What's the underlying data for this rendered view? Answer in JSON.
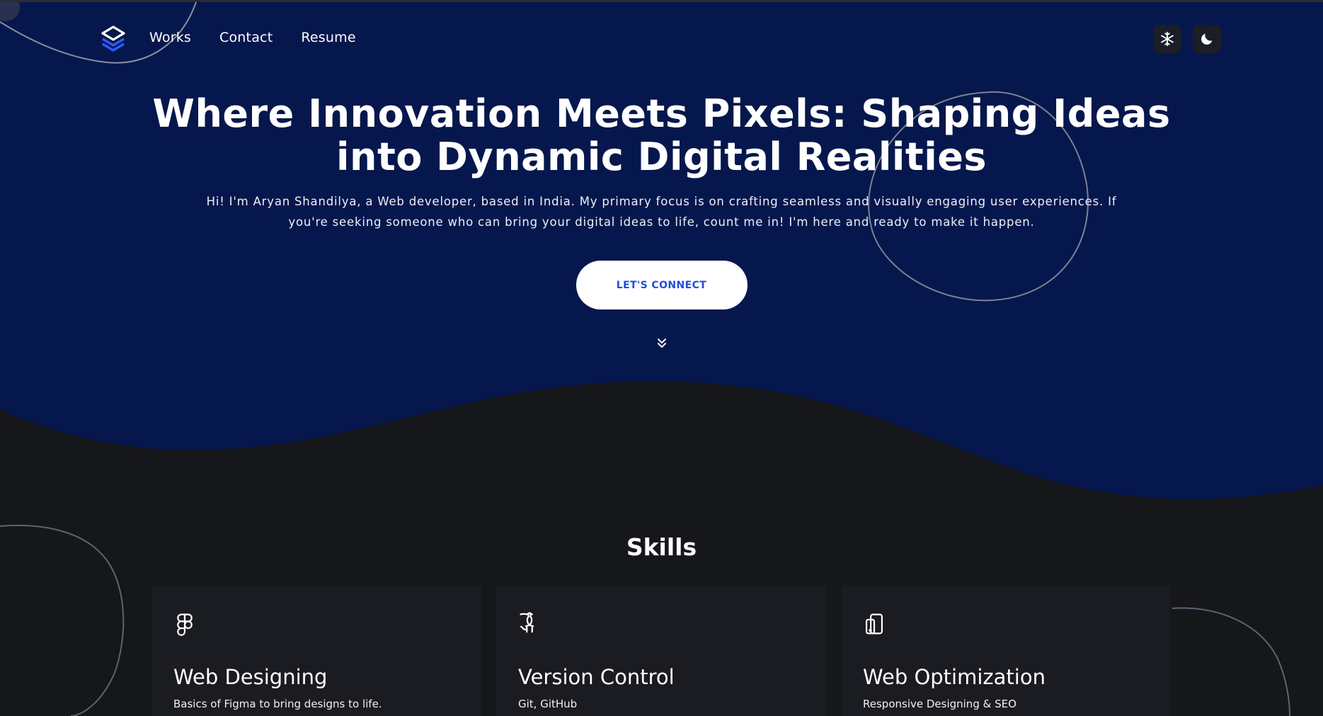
{
  "colors": {
    "hero_background": "#06174d",
    "page_background": "#16171b",
    "card_background": "#1b1c21",
    "cta_text": "#1f4fd8",
    "logo_accent": "#2f5bff"
  },
  "nav": {
    "logo_icon": "stacked-layers-logo",
    "links": [
      {
        "label": "Works"
      },
      {
        "label": "Contact"
      },
      {
        "label": "Resume"
      }
    ],
    "buttons": [
      {
        "icon": "snowflake-icon"
      },
      {
        "icon": "moon-icon"
      }
    ]
  },
  "hero": {
    "title_line1": "Where Innovation Meets Pixels: Shaping Ideas",
    "title_line2": "into Dynamic Digital Realities",
    "subtitle_line1": "Hi! I'm Aryan Shandilya, a Web developer, based in India. My primary focus is on crafting seamless and visually engaging user experiences. If",
    "subtitle_line2": "you're seeking someone who can bring your digital ideas to life, count me in! I'm here and ready to make it happen.",
    "cta_label": "LET'S CONNECT",
    "scroll_icon": "double-chevron-down-icon"
  },
  "skills": {
    "title": "Skills",
    "cards": [
      {
        "icon": "figma-icon",
        "title": "Web Designing",
        "description": "Basics of Figma to bring designs to life."
      },
      {
        "icon": "github-icon",
        "title": "Version Control",
        "description": "Git, GitHub"
      },
      {
        "icon": "mobile-device-icon",
        "title": "Web Optimization",
        "description": "Responsive Designing & SEO"
      }
    ]
  }
}
